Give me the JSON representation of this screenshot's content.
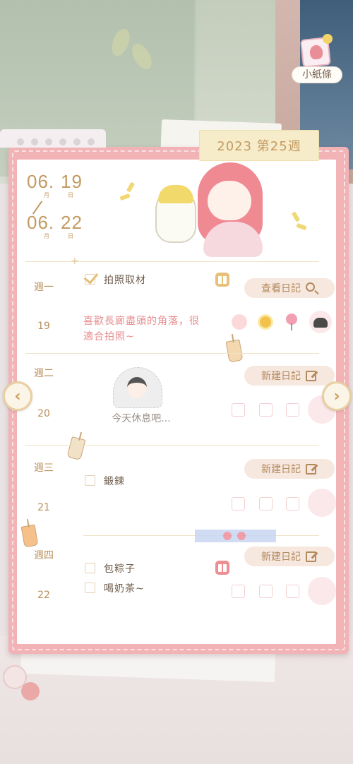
{
  "note_button": {
    "label": "小紙條"
  },
  "week_tab": {
    "label": "2023 第25週"
  },
  "date_range": {
    "start_month": "06.",
    "start_day": "19",
    "end_month": "06.",
    "end_day": "22",
    "month_unit": "月",
    "day_unit": "日"
  },
  "days": [
    {
      "weekday": "週一",
      "date": "19",
      "button_label": "查看日記",
      "button_icon": "search-icon",
      "tasks": [
        {
          "text": "拍照取材",
          "checked": true
        }
      ],
      "memo": "喜歡長廊盡頭的角落，很適合拍照~",
      "memo_line1": "喜歡長廊盡頭的角落，很",
      "memo_line2": "適合拍照~",
      "moods": [
        "blush-face-icon",
        "sun-icon",
        "flower-icon",
        "food-icon"
      ]
    },
    {
      "weekday": "週二",
      "date": "20",
      "button_label": "新建日記",
      "button_icon": "edit-icon",
      "rest_text": "今天休息吧..."
    },
    {
      "weekday": "週三",
      "date": "21",
      "button_label": "新建日記",
      "button_icon": "edit-icon",
      "tasks": [
        {
          "text": "鍛鍊",
          "checked": false
        }
      ]
    },
    {
      "weekday": "週四",
      "date": "22",
      "button_label": "新建日記",
      "button_icon": "edit-icon",
      "tasks": [
        {
          "text": "包粽子",
          "checked": false
        },
        {
          "text": "喝奶茶~",
          "checked": false
        }
      ]
    }
  ],
  "colors": {
    "accent_gold": "#c39a62",
    "memo_pink": "#e68b8e",
    "frame_pink": "#f2b3b7",
    "button_bg": "#f6e7df"
  }
}
